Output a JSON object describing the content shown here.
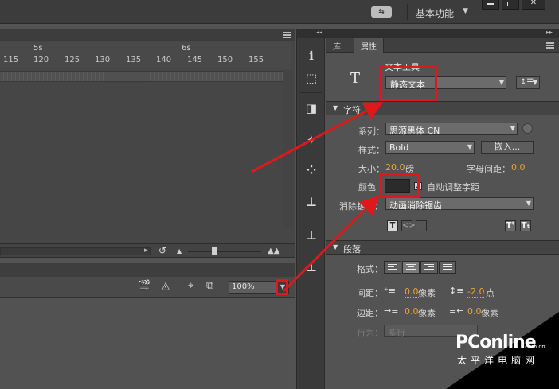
{
  "app": {
    "workspace_label": "基本功能",
    "workspace_switch_icon": "workspace-sync-icon",
    "window_close": "✕"
  },
  "timeline": {
    "seconds": [
      "5s",
      "6s"
    ],
    "frames": [
      "115",
      "120",
      "125",
      "130",
      "135",
      "140",
      "145",
      "150",
      "155"
    ]
  },
  "stage": {
    "zoom": "100%"
  },
  "panel": {
    "tabs": [
      "库",
      "属性"
    ],
    "tool_name": "文本工具",
    "text_type": "静态文本",
    "tool_glyph": "T",
    "character": {
      "section_label": "字符",
      "family_label": "系列：",
      "family_value": "思源黑体 CN",
      "style_label": "样式：",
      "style_value": "Bold",
      "embed_button": "嵌入...",
      "size_label": "大小：",
      "size_value": "20.0",
      "size_unit": "磅",
      "letter_spacing_label": "字母间距：",
      "letter_spacing_value": "0.0",
      "color_label": "颜色",
      "color_value": "#2b2b2b",
      "auto_kern_label": "自动调整字距",
      "auto_kern_checked": true,
      "antialias_label": "消除锯齿：",
      "antialias_value": "动画消除锯齿"
    },
    "paragraph": {
      "section_label": "段落",
      "format_label": "格式：",
      "spacing_label": "间距：",
      "indent_value": "0.0",
      "indent_unit": "像素",
      "line_spacing_value": "-2.0",
      "line_spacing_unit": "点",
      "margin_label": "边距：",
      "left_margin_value": "0.0",
      "left_margin_unit": "像素",
      "right_margin_value": "0.0",
      "right_margin_unit": "像素",
      "behavior_label": "行为：",
      "behavior_value": "多行"
    }
  },
  "annotations": {
    "highlight_color": "#e0181c"
  },
  "watermark": {
    "brand": "PConline",
    "domain": ".com.cn",
    "sub": "太平洋电脑网"
  }
}
